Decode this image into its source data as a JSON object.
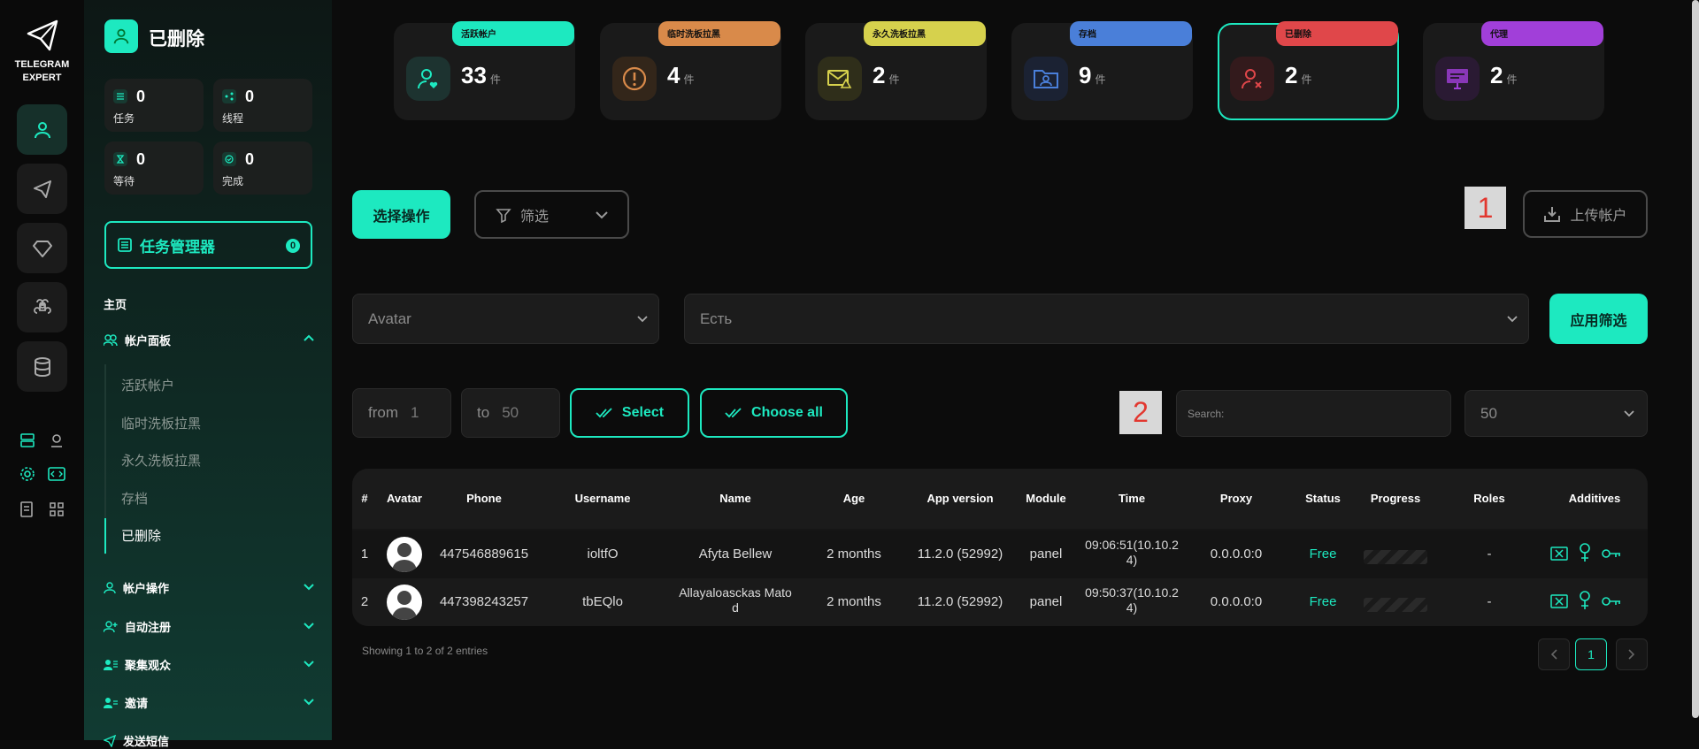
{
  "app": {
    "logo_line1": "TELEGRAM",
    "logo_line2": "EXPERT"
  },
  "colors": {
    "accent": "#1de9c0",
    "bg": "#0c0c0c",
    "danger": "#e2372f"
  },
  "sidebar": {
    "title": "已删除",
    "stats": [
      {
        "label": "任务",
        "value": "0",
        "icon": "list-icon"
      },
      {
        "label": "线程",
        "value": "0",
        "icon": "share-icon"
      },
      {
        "label": "等待",
        "value": "0",
        "icon": "hourglass-icon"
      },
      {
        "label": "完成",
        "value": "0",
        "icon": "check-circle-icon"
      }
    ],
    "task_manager": {
      "label": "任务管理器",
      "count": "0"
    },
    "home_label": "主页",
    "account_panel": "帐户面板",
    "sub_items": [
      "活跃帐户",
      "临时洗板拉黑",
      "永久洗板拉黑",
      "存档",
      "已删除"
    ],
    "sections": [
      "帐户操作",
      "自动注册",
      "聚集观众",
      "邀请",
      "发送短信"
    ]
  },
  "cards": [
    {
      "tag": "活跃帐户",
      "count": "33",
      "unit": "件",
      "color": "#1de9c0"
    },
    {
      "tag": "临时洗板拉黑",
      "count": "4",
      "unit": "件",
      "color": "#d98a4a"
    },
    {
      "tag": "永久洗板拉黑",
      "count": "2",
      "unit": "件",
      "color": "#d6d14d"
    },
    {
      "tag": "存档",
      "count": "9",
      "unit": "件",
      "color": "#4a7fd9"
    },
    {
      "tag": "已删除",
      "count": "2",
      "unit": "件",
      "color": "#e0474a"
    },
    {
      "tag": "代理",
      "count": "2",
      "unit": "件",
      "color": "#a13fd9"
    }
  ],
  "toolbar": {
    "select_action": "选择操作",
    "filter": "筛选",
    "badge1": "1",
    "upload": "上传帐户",
    "filter_field": "Avatar",
    "filter_value": "Есть",
    "apply_filter": "应用筛选",
    "from_label": "from",
    "from_value": "1",
    "to_label": "to",
    "to_value": "50",
    "select": "Select",
    "choose_all": "Choose all",
    "badge2": "2",
    "search_placeholder": "Search:",
    "page_size": "50"
  },
  "table": {
    "headers": [
      "#",
      "Avatar",
      "Phone",
      "Username",
      "Name",
      "Age",
      "App version",
      "Module",
      "Time",
      "Proxy",
      "Status",
      "Progress",
      "Roles",
      "Additives"
    ],
    "rows": [
      {
        "num": "1",
        "phone": "447546889615",
        "username": "ioltfO",
        "name_l1": "Afyta Bellew",
        "name_l2": "",
        "age": "2 months",
        "app_version": "11.2.0 (52992)",
        "module": "panel",
        "time_l1": "09:06:51(10.10.2",
        "time_l2": "4)",
        "proxy": "0.0.0.0:0",
        "status": "Free",
        "roles": "-"
      },
      {
        "num": "2",
        "phone": "447398243257",
        "username": "tbEQlo",
        "name_l1": "Allayaloasckas Mato",
        "name_l2": "d",
        "age": "2 months",
        "app_version": "11.2.0 (52992)",
        "module": "panel",
        "time_l1": "09:50:37(10.10.2",
        "time_l2": "4)",
        "proxy": "0.0.0.0:0",
        "status": "Free",
        "roles": "-"
      }
    ],
    "footer": "Showing 1 to 2 of 2 entries",
    "page": "1"
  }
}
